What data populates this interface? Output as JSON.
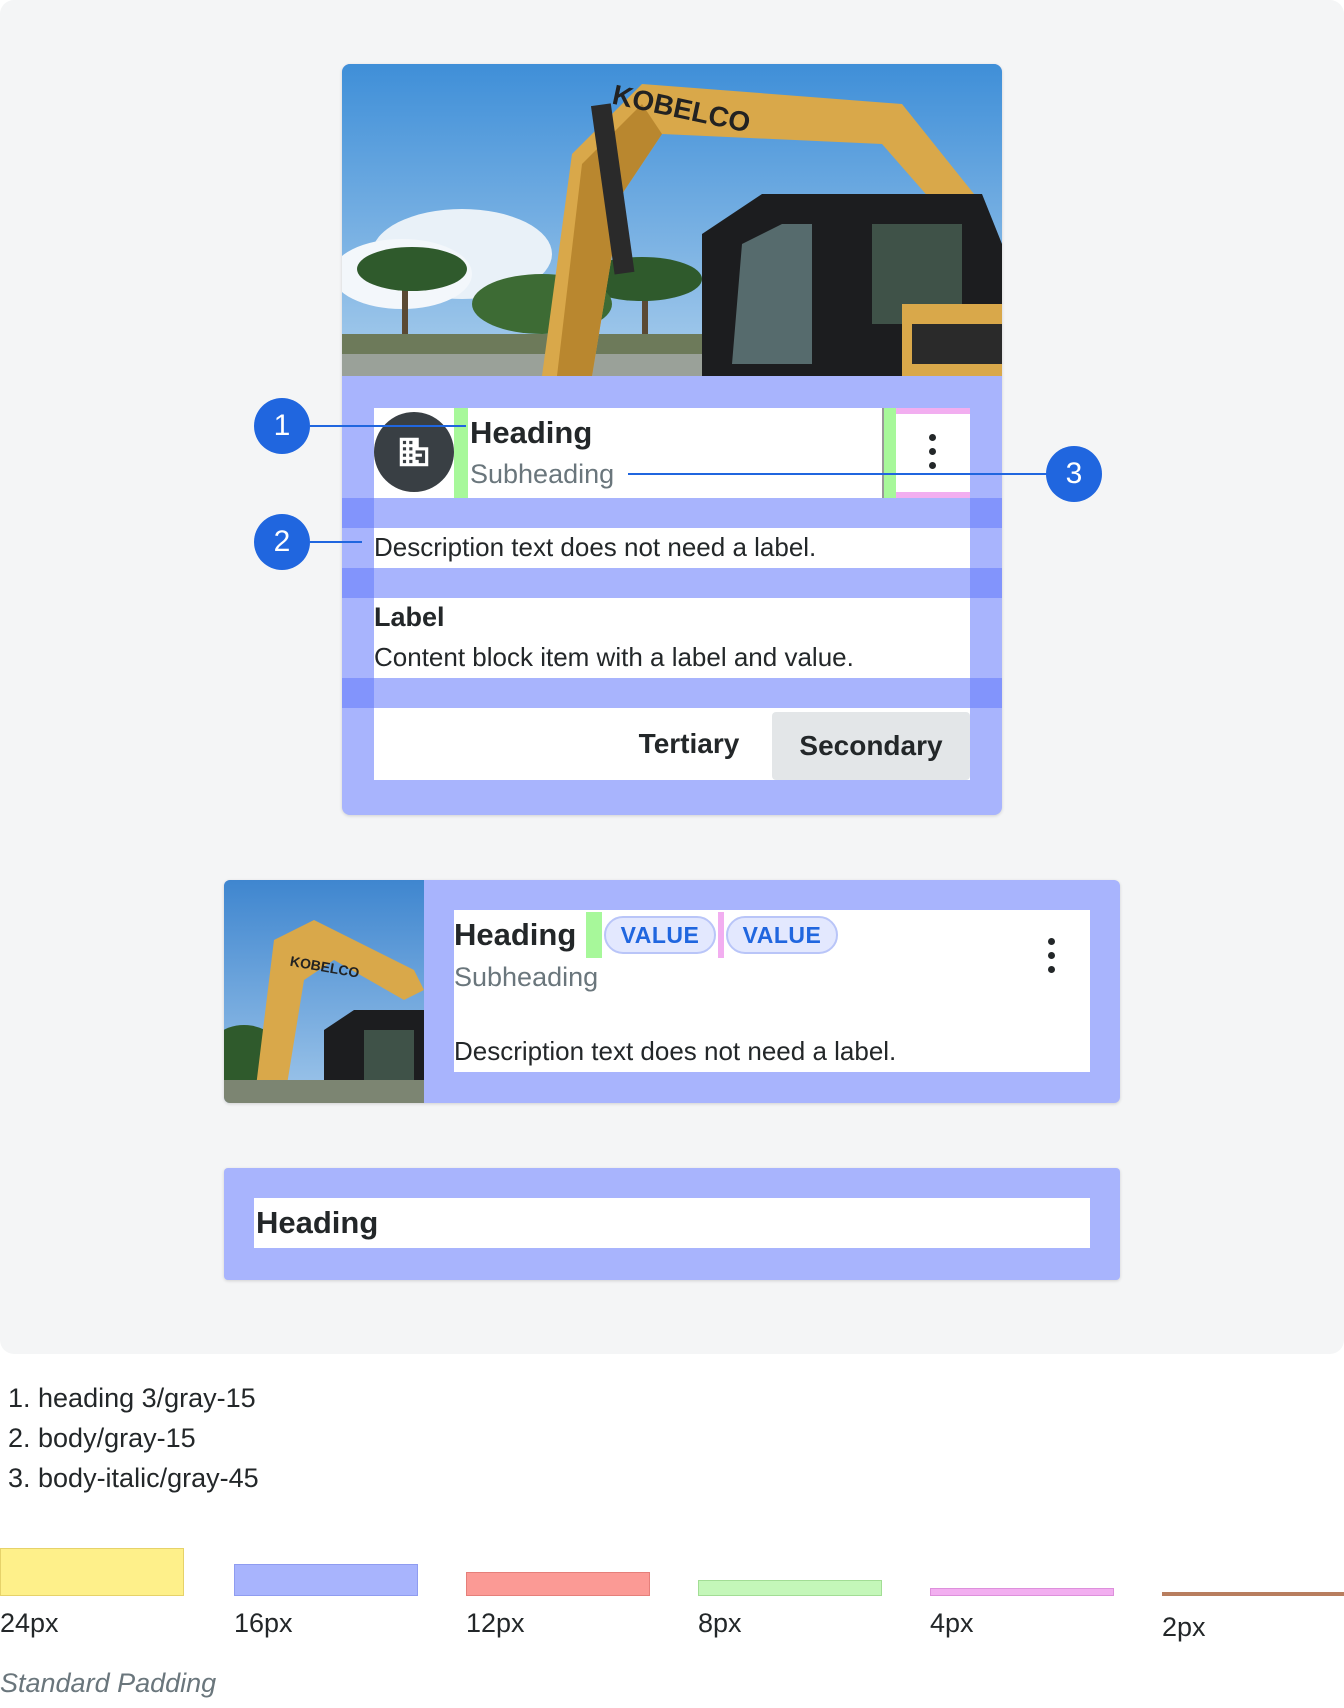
{
  "card1": {
    "heading": "Heading",
    "subheading": "Subheading",
    "description": "Description text does not need a label.",
    "label": "Label",
    "value": "Content block item with a label and value.",
    "buttons": {
      "tertiary": "Tertiary",
      "secondary": "Secondary"
    },
    "avatar_icon": "building-icon",
    "menu_icon": "kebab-menu-icon"
  },
  "card2": {
    "heading": "Heading",
    "subheading": "Subheading",
    "description": "Description text does not need a label.",
    "chips": [
      "VALUE",
      "VALUE"
    ]
  },
  "card3": {
    "heading": "Heading"
  },
  "callouts": [
    "1",
    "2",
    "3"
  ],
  "legend": [
    "1. heading 3/gray-15",
    "2. body/gray-15",
    "3. body-italic/gray-45"
  ],
  "swatches": [
    {
      "label": "24px",
      "color": "#fef08a"
    },
    {
      "label": "16px",
      "color": "#a8b4fd"
    },
    {
      "label": "12px",
      "color": "#fb9a95"
    },
    {
      "label": "8px",
      "color": "#c4f7b9"
    },
    {
      "label": "4px",
      "color": "#f2aef0"
    },
    {
      "label": "2px",
      "color": "#b87e5f"
    }
  ],
  "footer_note": "Standard Padding",
  "colors": {
    "padding_overlay": "#a8b4fd",
    "accent": "#2066df",
    "panel_bg": "#f4f5f6"
  }
}
